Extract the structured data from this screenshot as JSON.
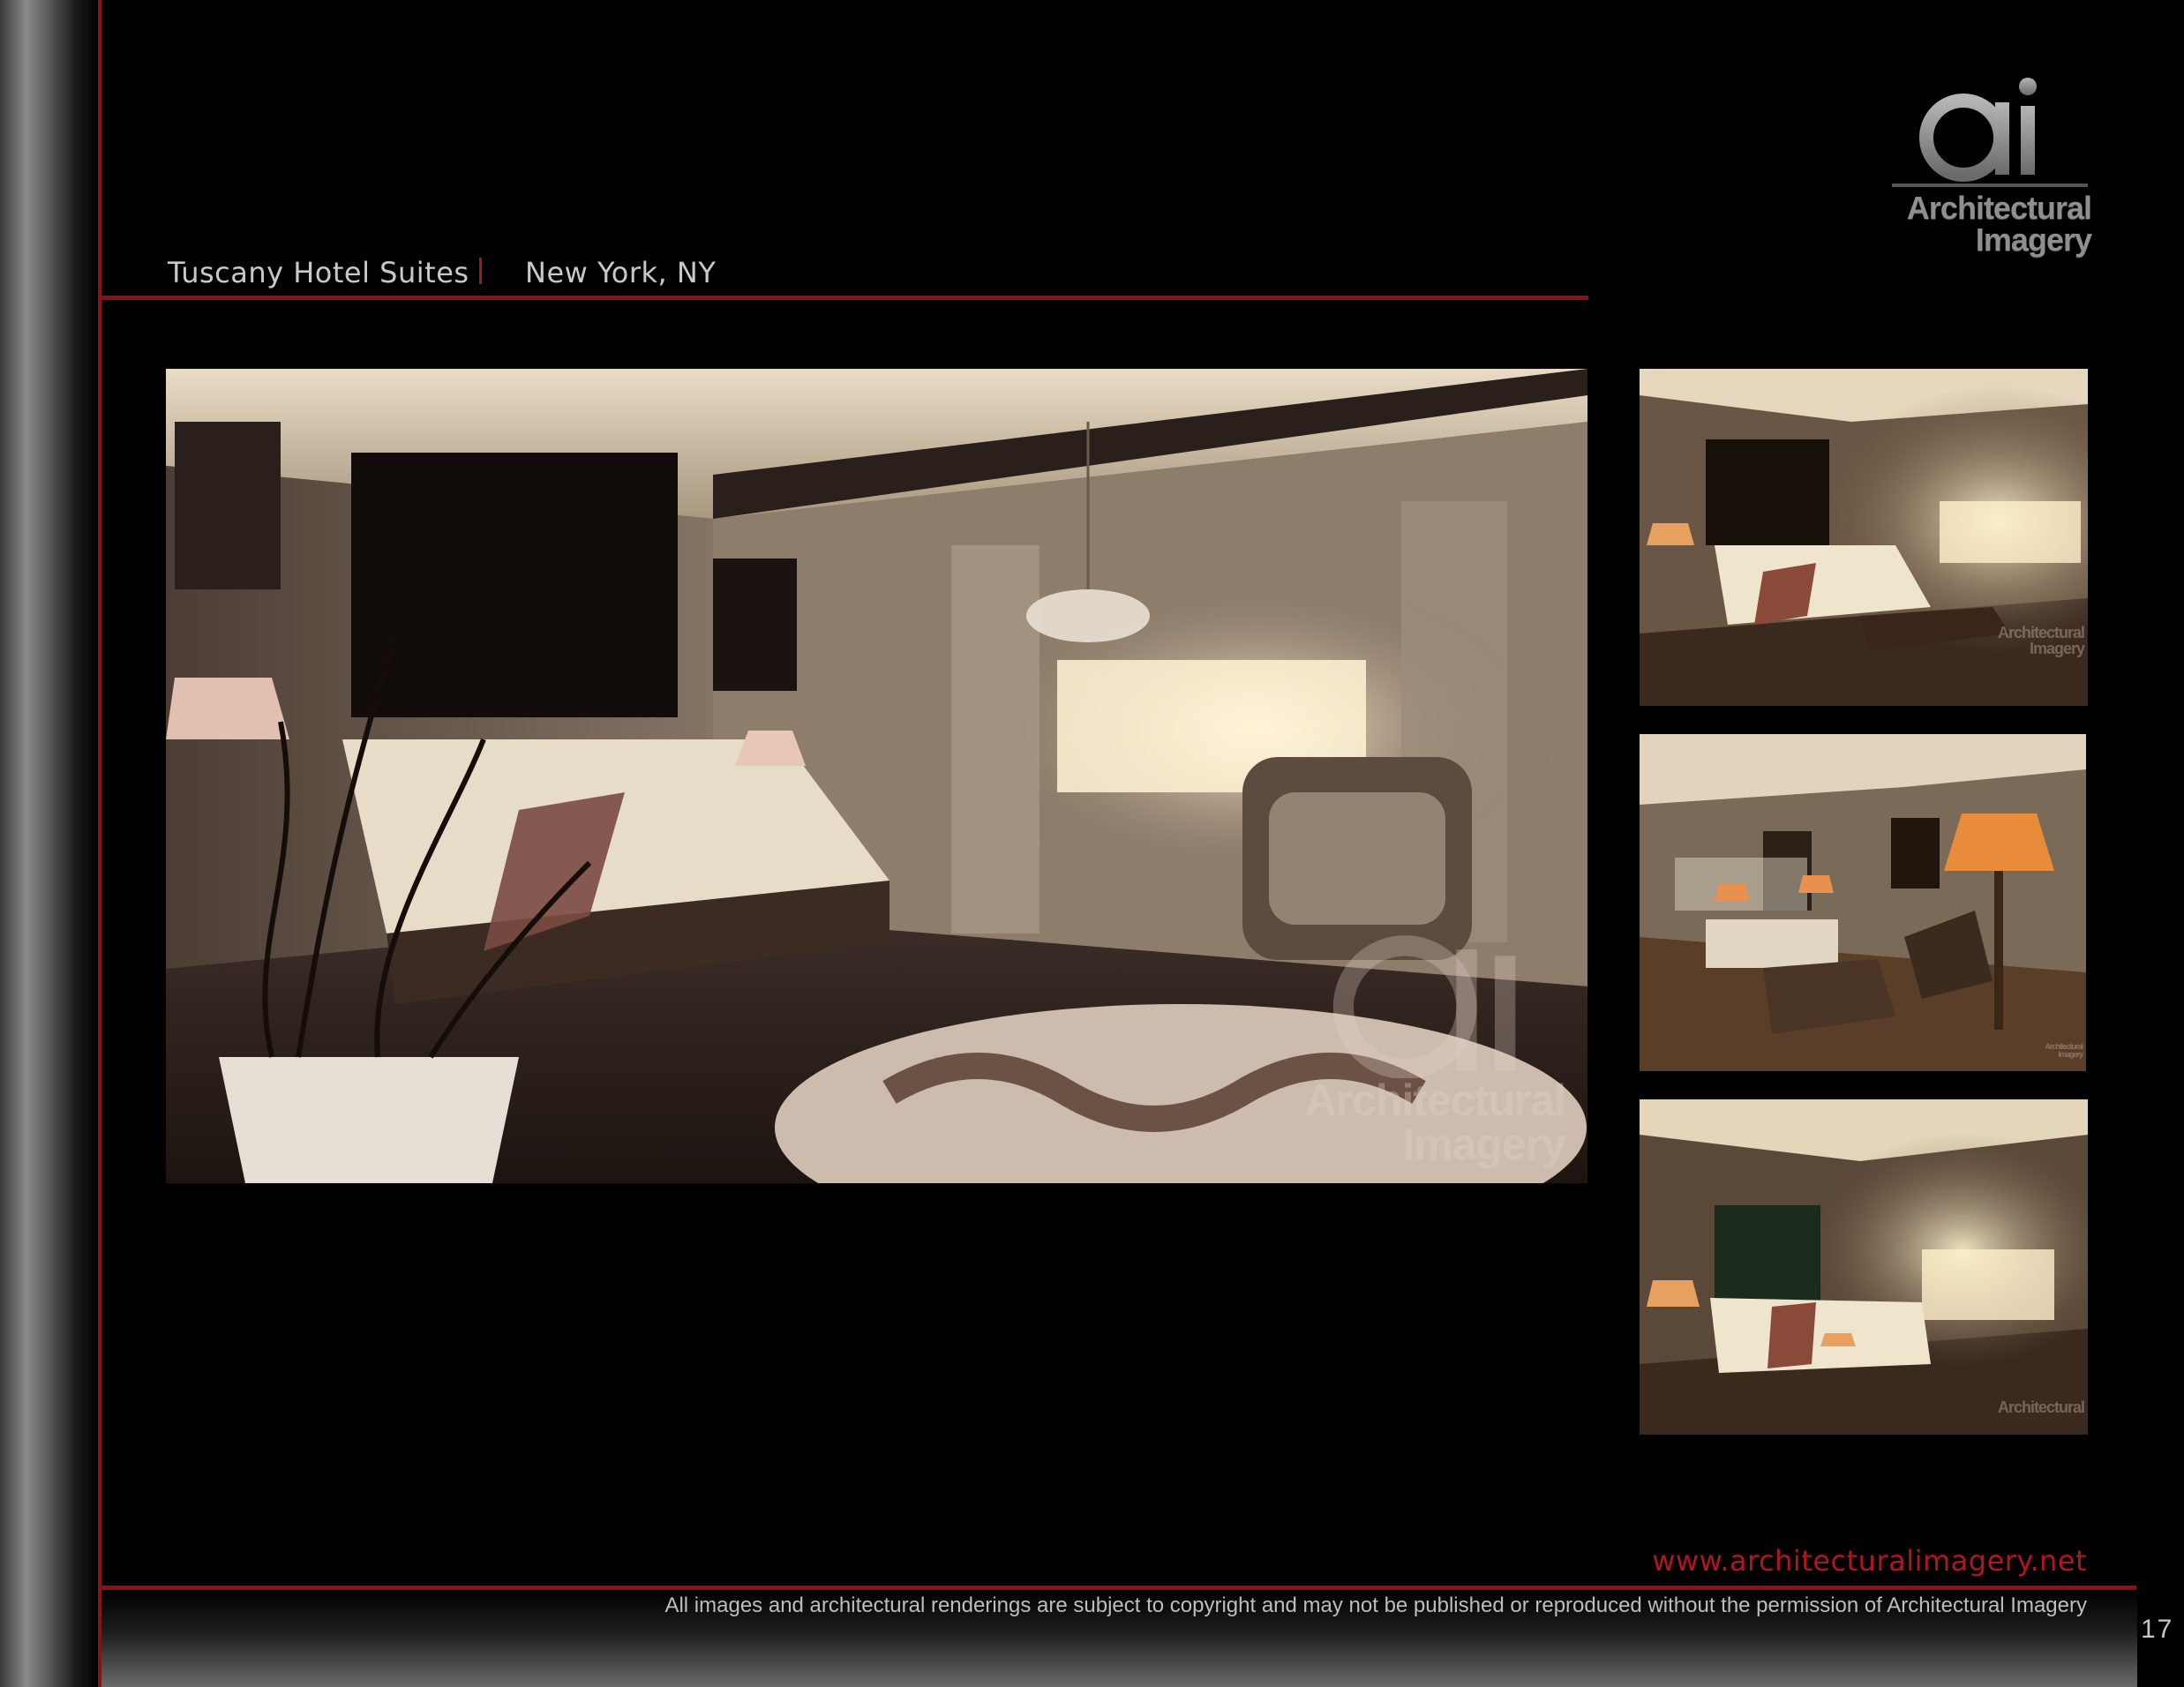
{
  "header": {
    "project": "Tuscany Hotel Suites",
    "location": "New York, NY"
  },
  "logo": {
    "mark": "ai",
    "line1": "Architectural",
    "line2": "Imagery"
  },
  "watermark": {
    "line1": "Architectural",
    "line2": "Imagery"
  },
  "footer": {
    "website": "www.architecturalimagery.net",
    "copyright": "All images and architectural renderings are subject to copyright and may not be published or reproduced without the permission of Architectural Imagery",
    "page_number": "17"
  },
  "colors": {
    "accent_red": "#8b1018",
    "website_red": "#b0161f",
    "background": "#000000"
  }
}
